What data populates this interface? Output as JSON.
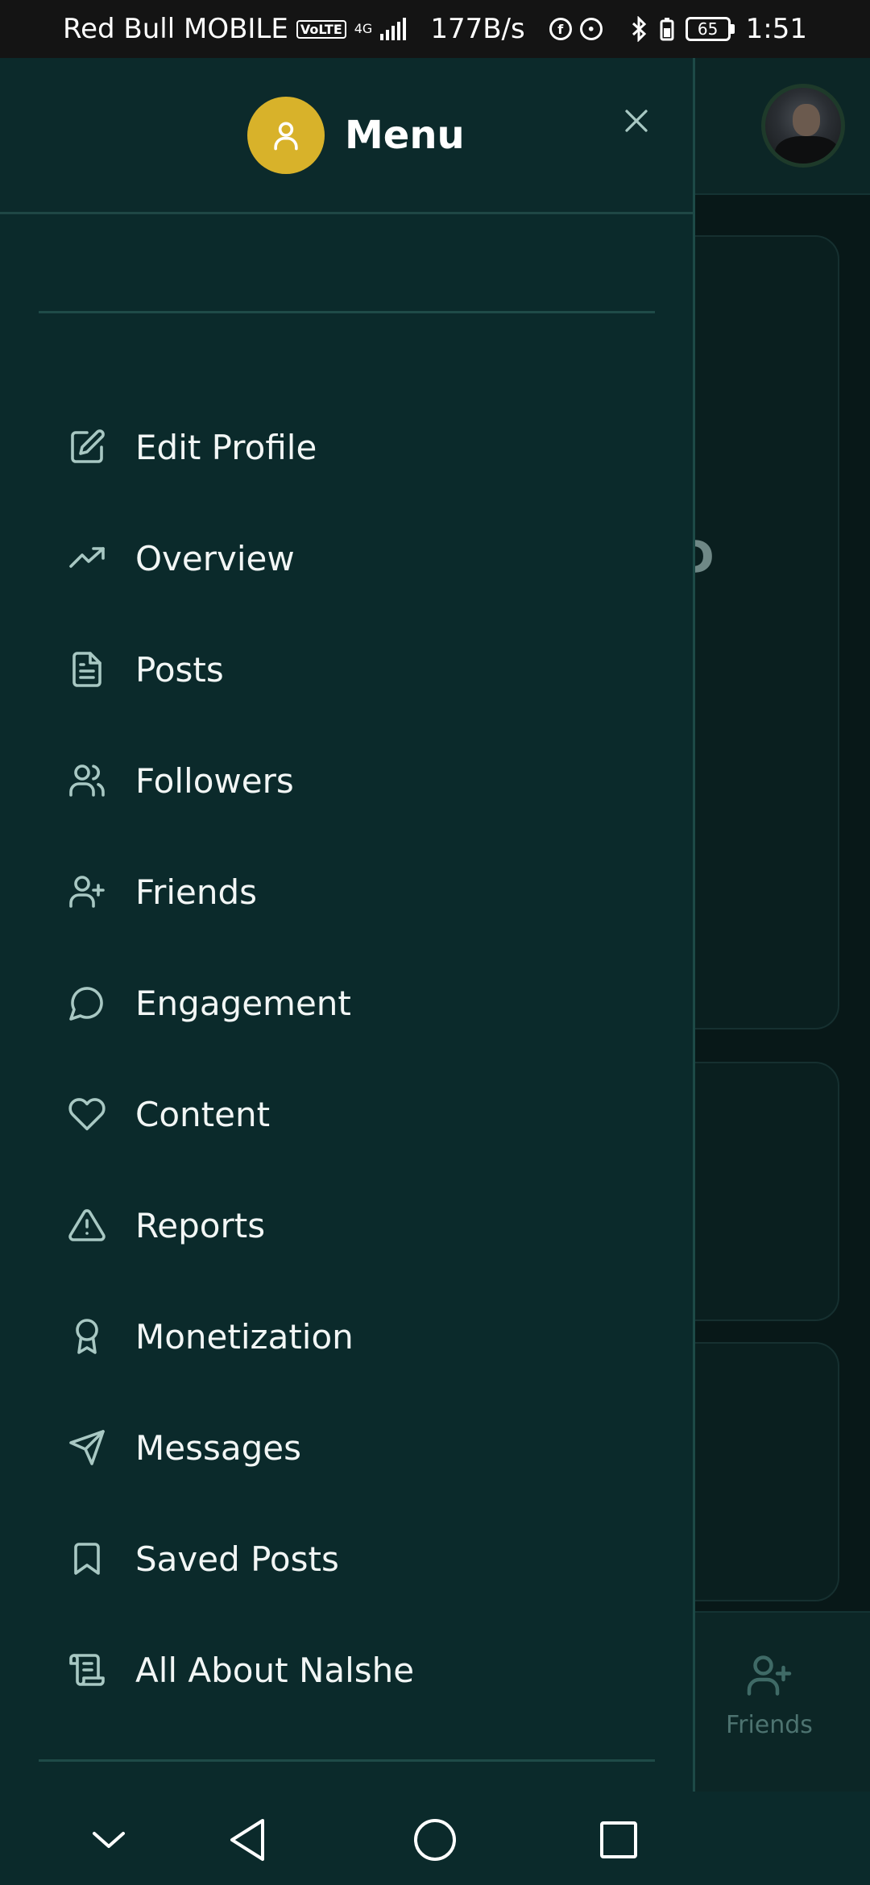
{
  "status_bar": {
    "carrier": "Red Bull MOBILE",
    "volte": "VoLTE",
    "network": "4G",
    "speed": "177B/s",
    "battery": "65",
    "time": "1:51"
  },
  "drawer": {
    "title": "Menu",
    "items": [
      {
        "label": "Edit Profile",
        "icon": "edit-icon"
      },
      {
        "label": "Overview",
        "icon": "trending-up-icon"
      },
      {
        "label": "Posts",
        "icon": "document-icon"
      },
      {
        "label": "Followers",
        "icon": "users-icon"
      },
      {
        "label": "Friends",
        "icon": "user-plus-icon"
      },
      {
        "label": "Engagement",
        "icon": "chat-bubble-icon"
      },
      {
        "label": "Content",
        "icon": "heart-icon"
      },
      {
        "label": "Reports",
        "icon": "warning-icon"
      },
      {
        "label": "Monetization",
        "icon": "award-icon"
      },
      {
        "label": "Messages",
        "icon": "send-icon"
      },
      {
        "label": "Saved Posts",
        "icon": "bookmark-icon"
      },
      {
        "label": "All About Nalshe",
        "icon": "scroll-icon"
      }
    ]
  },
  "background": {
    "partial_word": "ED",
    "bottom_nav_label": "Friends"
  },
  "colors": {
    "drawer_bg": "#0b2a2b",
    "accent_avatar": "#d8b22a",
    "icon_color": "#a8c8c3"
  }
}
